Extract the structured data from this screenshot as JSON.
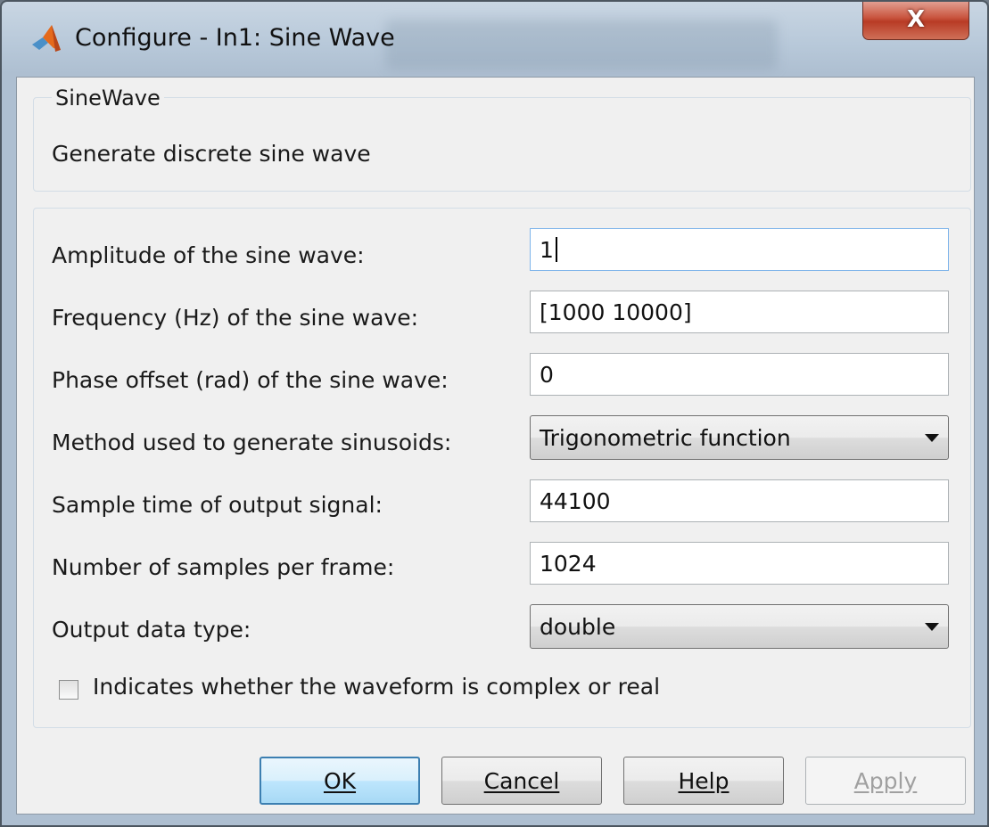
{
  "window": {
    "title": "Configure - In1: Sine Wave",
    "close_label": "X",
    "app_icon": "matlab-logo-icon",
    "accent_colors": {
      "close": "#c9553f",
      "default_button": "#3c7fb1"
    }
  },
  "description_group": {
    "title": "SineWave",
    "description": "Generate discrete sine wave"
  },
  "parameters": {
    "amplitude": {
      "label": "Amplitude of the sine wave:",
      "value": "1"
    },
    "frequency": {
      "label": "Frequency (Hz) of the sine wave:",
      "value": "[1000 10000]"
    },
    "phase": {
      "label": "Phase offset (rad) of the sine wave:",
      "value": "0"
    },
    "method": {
      "label": "Method used to generate sinusoids:",
      "value": "Trigonometric function"
    },
    "sample_time": {
      "label": "Sample time of output signal:",
      "value": "44100"
    },
    "samples_per_frame": {
      "label": "Number of samples per frame:",
      "value": "1024"
    },
    "data_type": {
      "label": "Output data type:",
      "value": "double"
    },
    "complex": {
      "label": "Indicates whether the waveform is complex or real",
      "checked": false
    }
  },
  "buttons": {
    "ok": "OK",
    "cancel": "Cancel",
    "help": "Help",
    "apply": "Apply"
  }
}
